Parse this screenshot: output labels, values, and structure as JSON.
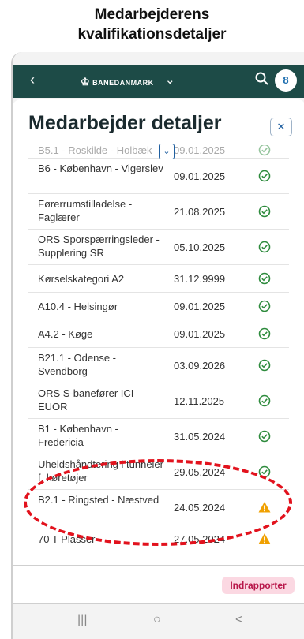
{
  "caption": {
    "line1": "Medarbejderens",
    "line2": "kvalifikationsdetaljer"
  },
  "appbar": {
    "back": "‹",
    "brand": "BANEDANMARK",
    "brand_chevron": "⌄",
    "user_initial": "8"
  },
  "sheet": {
    "title": "Medarbejder detaljer",
    "close": "✕"
  },
  "qualifications": [
    {
      "name": "B5.1 - Roskilde - Holbæk",
      "date": "09.01.2025",
      "status": "valid"
    },
    {
      "name": "B6 - København - Vigerslev",
      "date": "09.01.2025",
      "status": "valid"
    },
    {
      "name": "Førerrumstilladelse - Faglærer",
      "date": "21.08.2025",
      "status": "valid"
    },
    {
      "name": "ORS Sporspærringsleder - Supplering SR",
      "date": "05.10.2025",
      "status": "valid"
    },
    {
      "name": "Kørselskategori A2",
      "date": "31.12.9999",
      "status": "valid"
    },
    {
      "name": "A10.4 - Helsingør",
      "date": "09.01.2025",
      "status": "valid"
    },
    {
      "name": "A4.2 - Køge",
      "date": "09.01.2025",
      "status": "valid"
    },
    {
      "name": "B21.1 - Odense - Svendborg",
      "date": "03.09.2026",
      "status": "valid"
    },
    {
      "name": "ORS S-banefører ICI EUOR",
      "date": "12.11.2025",
      "status": "valid"
    },
    {
      "name": "B1 - København - Fredericia",
      "date": "31.05.2024",
      "status": "valid"
    },
    {
      "name": "Uheldshåndtering i tunneler f. køretøjer",
      "date": "29.05.2024",
      "status": "valid"
    },
    {
      "name": "B2.1 - Ringsted - Næstved",
      "date": "24.05.2024",
      "status": "warning"
    },
    {
      "name": "70 T Plasser",
      "date": "27.05.2024",
      "status": "warning"
    }
  ],
  "footer": {
    "report_label": "Indrapporter"
  },
  "navbar": {
    "recent": "|||",
    "home": "○",
    "back": "<"
  },
  "colors": {
    "appbar": "#1d4b47",
    "valid": "#2e8b3d",
    "warning": "#f0a000",
    "highlight": "#e2121d",
    "report_bg": "#fbd8e2",
    "report_text": "#b8174a"
  }
}
